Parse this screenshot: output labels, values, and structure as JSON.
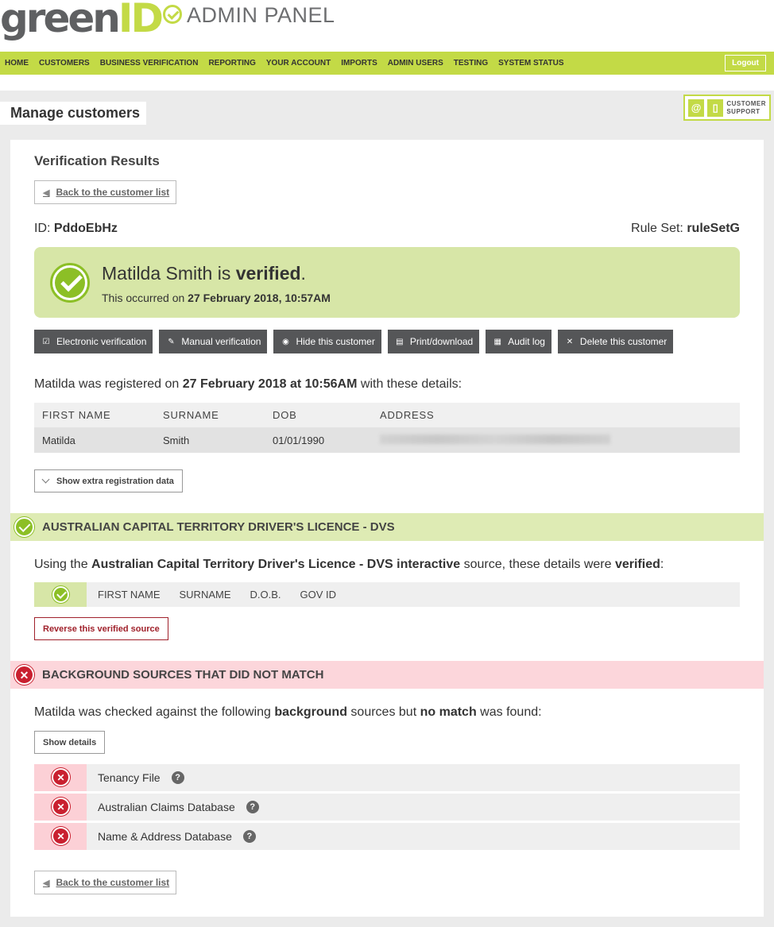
{
  "brand": {
    "logo_green": "green",
    "logo_id": "ID",
    "subtitle": "ADMIN PANEL"
  },
  "nav": {
    "items": [
      "HOME",
      "CUSTOMERS",
      "BUSINESS VERIFICATION",
      "REPORTING",
      "YOUR ACCOUNT",
      "IMPORTS",
      "ADMIN USERS",
      "TESTING",
      "SYSTEM STATUS"
    ],
    "logout": "Logout"
  },
  "page_title": "Manage customers",
  "support": {
    "line1": "CUSTOMER",
    "line2": "SUPPORT",
    "icon1": "@"
  },
  "results": {
    "heading": "Verification Results",
    "back_label": "Back to the customer list",
    "id_label": "ID:",
    "id_value": "PddoEbHz",
    "ruleset_label": "Rule Set:",
    "ruleset_value": "ruleSetG",
    "verified_name": "Matilda Smith is",
    "verified_word": "verified",
    "verified_dot": ".",
    "occurred_prefix": "This occurred on",
    "occurred_date": "27 February 2018, 10:57AM"
  },
  "actions": [
    {
      "label": "Electronic verification",
      "icon": "check-box-icon",
      "glyph": "☑"
    },
    {
      "label": "Manual verification",
      "icon": "edit-icon",
      "glyph": "✎"
    },
    {
      "label": "Hide this customer",
      "icon": "eye-icon",
      "glyph": "◉"
    },
    {
      "label": "Print/download",
      "icon": "print-icon",
      "glyph": "▤"
    },
    {
      "label": "Audit log",
      "icon": "clipboard-icon",
      "glyph": "▦"
    },
    {
      "label": "Delete this customer",
      "icon": "delete-icon",
      "glyph": "✕"
    }
  ],
  "registration": {
    "prefix": "Matilda was registered on",
    "date": "27 February 2018 at 10:56AM",
    "suffix": "with these details:",
    "headers": [
      "FIRST NAME",
      "SURNAME",
      "DOB",
      "ADDRESS"
    ],
    "row": [
      "Matilda",
      "Smith",
      "01/01/1990",
      ""
    ],
    "extra_label": "Show extra registration data"
  },
  "verified_source": {
    "title": "AUSTRALIAN CAPITAL TERRITORY DRIVER'S LICENCE - DVS",
    "using_prefix": "Using the",
    "source_name": "Australian Capital Territory Driver's Licence - DVS interactive",
    "using_middle": "source, these details were",
    "verified_word": "verified",
    "colon": ":",
    "fields": [
      "FIRST NAME",
      "SURNAME",
      "D.O.B.",
      "GOV ID"
    ],
    "reverse_label": "Reverse this verified source"
  },
  "background": {
    "title": "BACKGROUND SOURCES THAT DID NOT MATCH",
    "line_prefix": "Matilda was checked against the following",
    "line_bold1": "background",
    "line_middle": "sources but",
    "line_bold2": "no match",
    "line_suffix": "was found:",
    "details_label": "Show details",
    "sources": [
      "Tenancy File",
      "Australian Claims Database",
      "Name & Address Database"
    ]
  },
  "colors": {
    "brand_green": "#c3da46",
    "verified_green": "#8cbf26",
    "error_red": "#c9202f",
    "success_bg": "#d7e6a7",
    "error_bg": "#fcd6db"
  }
}
